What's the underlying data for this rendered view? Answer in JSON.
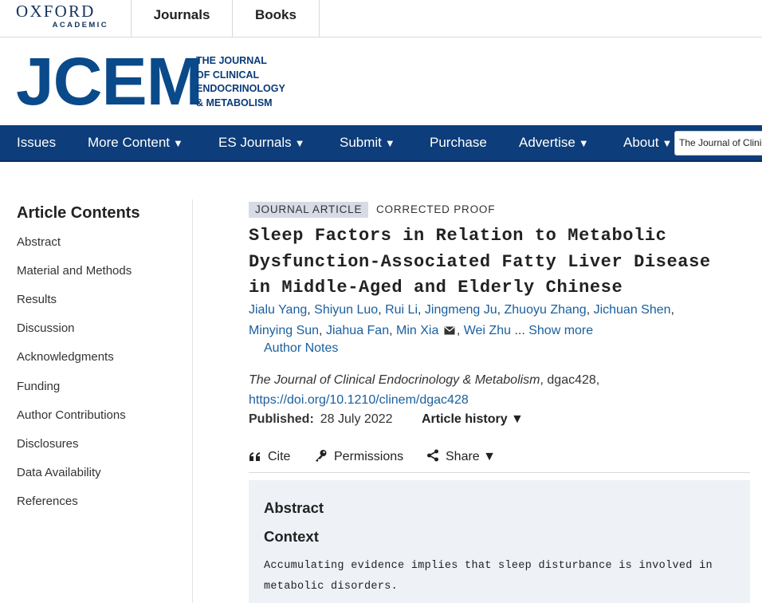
{
  "topbar": {
    "logo_line1": "OXFORD",
    "logo_line2": "ACADEMIC",
    "links": [
      "Journals",
      "Books"
    ]
  },
  "brand": {
    "logo": "JCEM",
    "subtitle_lines": [
      "THE JOURNAL",
      "OF CLINICAL",
      "ENDOCRINOLOGY",
      "& METABOLISM"
    ]
  },
  "nav": {
    "items": [
      {
        "label": "Issues",
        "caret": ""
      },
      {
        "label": "More Content",
        "caret": "▼"
      },
      {
        "label": "ES Journals",
        "caret": "▼"
      },
      {
        "label": "Submit",
        "caret": "▼"
      },
      {
        "label": "Purchase",
        "caret": ""
      },
      {
        "label": "Advertise",
        "caret": "▼"
      },
      {
        "label": "About",
        "caret": "▼"
      }
    ],
    "search_value": "The Journal of Clinical Endocrinology & Metabolism"
  },
  "sidebar": {
    "title": "Article Contents",
    "items": [
      "Abstract",
      "Material and Methods",
      "Results",
      "Discussion",
      "Acknowledgments",
      "Funding",
      "Author Contributions",
      "Disclosures",
      "Data Availability",
      "References"
    ]
  },
  "article": {
    "type_badge": "JOURNAL ARTICLE",
    "status": "CORRECTED PROOF",
    "title": "Sleep Factors in Relation to Metabolic Dysfunction-Associated Fatty Liver Disease in Middle-Aged and Elderly Chinese",
    "authors": [
      "Jialu Yang",
      "Shiyun Luo",
      "Rui Li",
      "Jingmeng Ju",
      "Zhuoyu Zhang",
      "Jichuan Shen",
      "Minying Sun",
      "Jiahua Fan",
      "Min Xia",
      "Wei Zhu"
    ],
    "ellipsis": "...",
    "show_more": "Show more",
    "author_notes": "Author Notes",
    "journal_name": "The Journal of Clinical Endocrinology & Metabolism",
    "article_id": ", dgac428,",
    "doi": "https://doi.org/10.1210/clinem/dgac428",
    "published_label": "Published:",
    "published_date": "28 July 2022",
    "history_label": "Article history ▼"
  },
  "tools": {
    "cite": "Cite",
    "permissions": "Permissions",
    "share": "Share ▼"
  },
  "abstract": {
    "heading": "Abstract",
    "subheading": "Context",
    "text": "Accumulating evidence implies that sleep disturbance is involved in metabolic disorders."
  },
  "colors": {
    "nav_bg": "#0d3d7a",
    "brand_blue": "#0a4a8a",
    "link_blue": "#1a5f9e",
    "badge_bg": "#d6dbe6",
    "abstract_bg": "#eef1f6"
  },
  "icons": [
    "envelope-icon",
    "quote-icon",
    "key-icon",
    "share-icon",
    "caret-down-icon"
  ]
}
